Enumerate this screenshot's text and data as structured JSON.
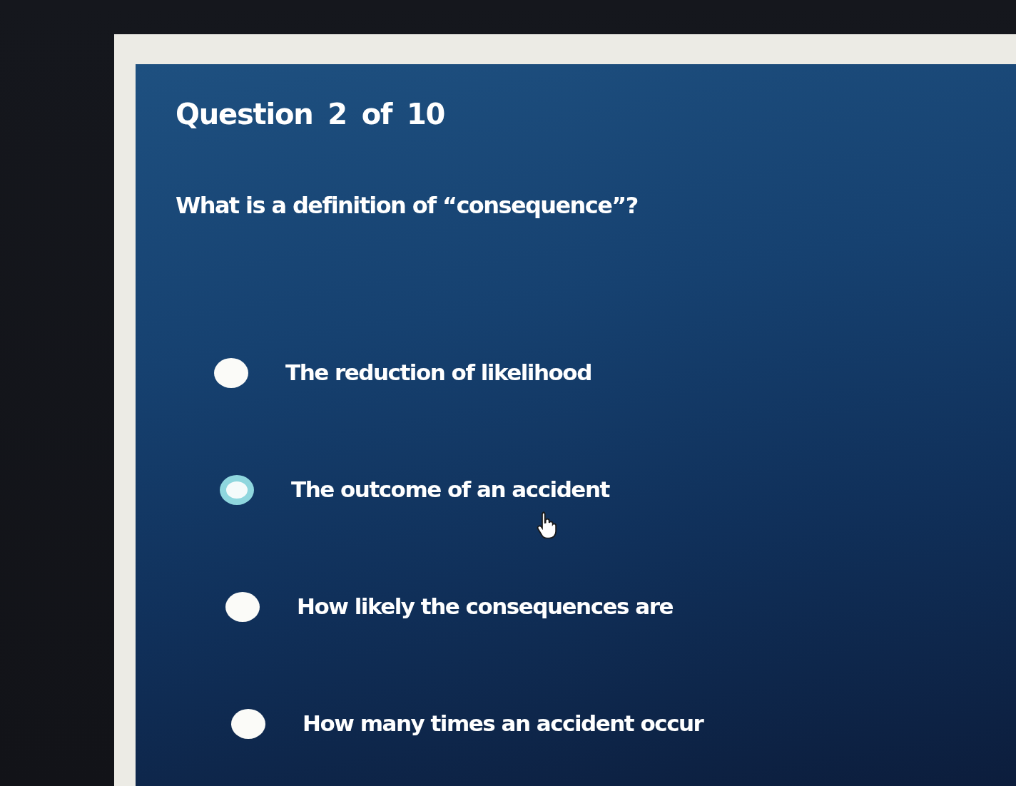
{
  "quiz": {
    "progress": "Question 2 of 10",
    "question": "What is a definition of “consequence”?",
    "options": [
      {
        "label": "The reduction of likelihood",
        "selected": false
      },
      {
        "label": "The outcome of an accident",
        "selected": true
      },
      {
        "label": "How likely the consequences are",
        "selected": false
      },
      {
        "label": "How many times an accident occur",
        "selected": false
      }
    ]
  }
}
